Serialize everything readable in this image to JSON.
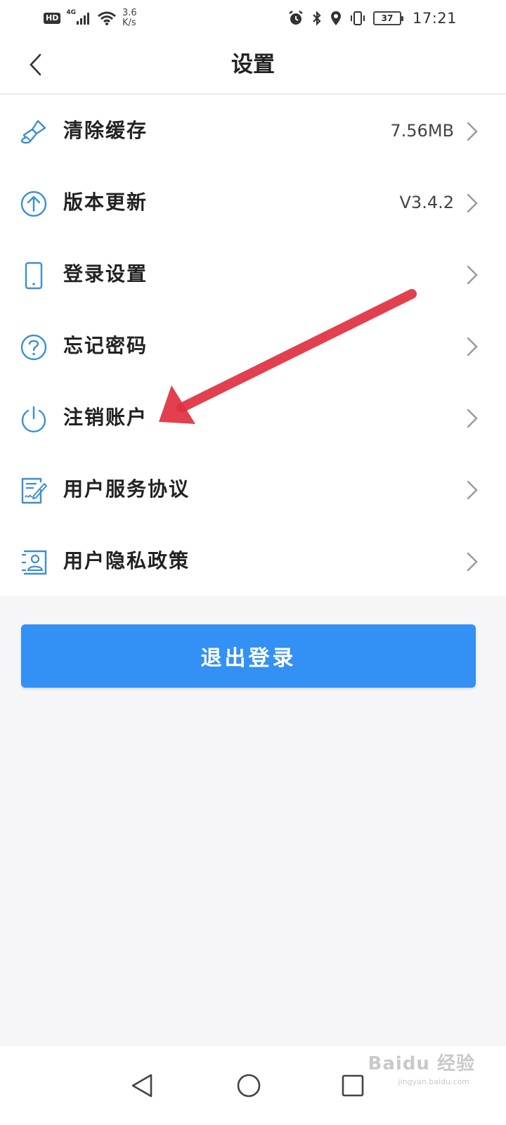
{
  "status_bar": {
    "hd": "HD",
    "network": "4G",
    "speed_value": "3.6",
    "speed_unit": "K/s",
    "battery": "37",
    "time": "17:21"
  },
  "header": {
    "title": "设置"
  },
  "settings": {
    "items": [
      {
        "label": "清除缓存",
        "value": "7.56MB",
        "icon": "brush-icon"
      },
      {
        "label": "版本更新",
        "value": "V3.4.2",
        "icon": "arrow-up-circle-icon"
      },
      {
        "label": "登录设置",
        "value": "",
        "icon": "phone-icon"
      },
      {
        "label": "忘记密码",
        "value": "",
        "icon": "question-circle-icon"
      },
      {
        "label": "注销账户",
        "value": "",
        "icon": "power-icon"
      },
      {
        "label": "用户服务协议",
        "value": "",
        "icon": "document-sign-icon"
      },
      {
        "label": "用户隐私政策",
        "value": "",
        "icon": "user-card-icon"
      }
    ]
  },
  "logout": {
    "label": "退出登录"
  },
  "watermark": {
    "text": "Baidu 经验",
    "sub": "jingyan.baidu.com"
  },
  "colors": {
    "accent": "#3390f5",
    "icon": "#3a8fd6",
    "annotation_arrow": "#e0303f"
  }
}
